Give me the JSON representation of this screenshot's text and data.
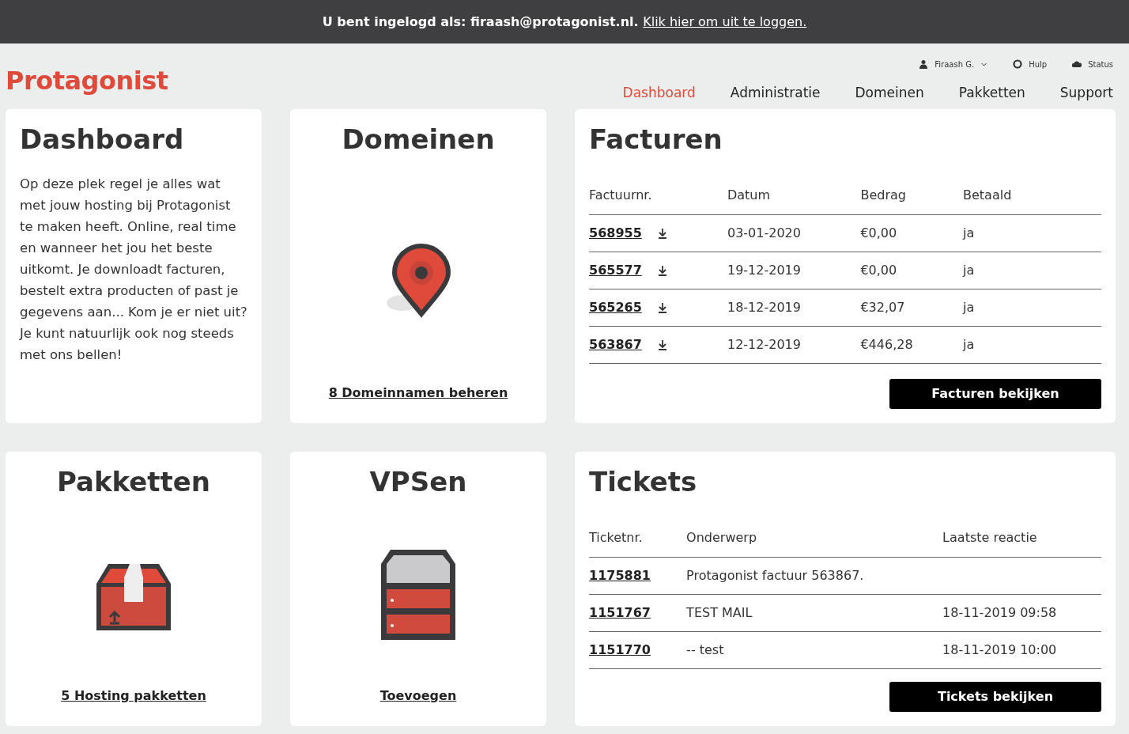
{
  "login_bar": {
    "text": "U bent ingelogd als: firaash@protagonist.nl.",
    "logout_link": "Klik hier om uit te loggen."
  },
  "logo": "Protagonist",
  "util_nav": [
    {
      "kind": "user",
      "label": "Firaash G."
    },
    {
      "kind": "help",
      "label": "Hulp"
    },
    {
      "kind": "status",
      "label": "Status"
    }
  ],
  "main_nav": [
    {
      "label": "Dashboard",
      "selected": true
    },
    {
      "label": "Administratie",
      "selected": false
    },
    {
      "label": "Domeinen",
      "selected": false
    },
    {
      "label": "Pakketten",
      "selected": false
    },
    {
      "label": "Support",
      "selected": false
    }
  ],
  "dashboard": {
    "title": "Dashboard",
    "text": "Op deze plek regel je alles wat met jouw hosting bij Protagonist te maken heeft. Online, real time en wanneer het jou het beste uitkomt. Je downloadt facturen, bestelt extra producten of past je gegevens aan... Kom je er niet uit? Je kunt natuurlijk ook nog steeds met ons bellen!"
  },
  "domeinen": {
    "title": "Domeinen",
    "link": "8 Domeinnamen beheren"
  },
  "facturen": {
    "title": "Facturen",
    "columns": [
      "Factuurnr.",
      "Datum",
      "Bedrag",
      "Betaald"
    ],
    "rows": [
      {
        "number": "568955",
        "date": "03-01-2020",
        "amount": "€0,00",
        "paid": "ja"
      },
      {
        "number": "565577",
        "date": "19-12-2019",
        "amount": "€0,00",
        "paid": "ja"
      },
      {
        "number": "565265",
        "date": "18-12-2019",
        "amount": "€32,07",
        "paid": "ja"
      },
      {
        "number": "563867",
        "date": "12-12-2019",
        "amount": "€446,28",
        "paid": "ja"
      }
    ],
    "button": "Facturen bekijken"
  },
  "pakketten": {
    "title": "Pakketten",
    "link": "5 Hosting pakketten"
  },
  "vpsen": {
    "title": "VPSen",
    "link": "Toevoegen"
  },
  "tickets": {
    "title": "Tickets",
    "columns": [
      "Ticketnr.",
      "Onderwerp",
      "Laatste reactie"
    ],
    "rows": [
      {
        "number": "1175881",
        "subject": "Protagonist factuur 563867.",
        "last_reply": ""
      },
      {
        "number": "1151767",
        "subject": "TEST MAIL",
        "last_reply": "18-11-2019 09:58"
      },
      {
        "number": "1151770",
        "subject": "-- test",
        "last_reply": "18-11-2019 10:00"
      }
    ],
    "button": "Tickets bekijken"
  }
}
